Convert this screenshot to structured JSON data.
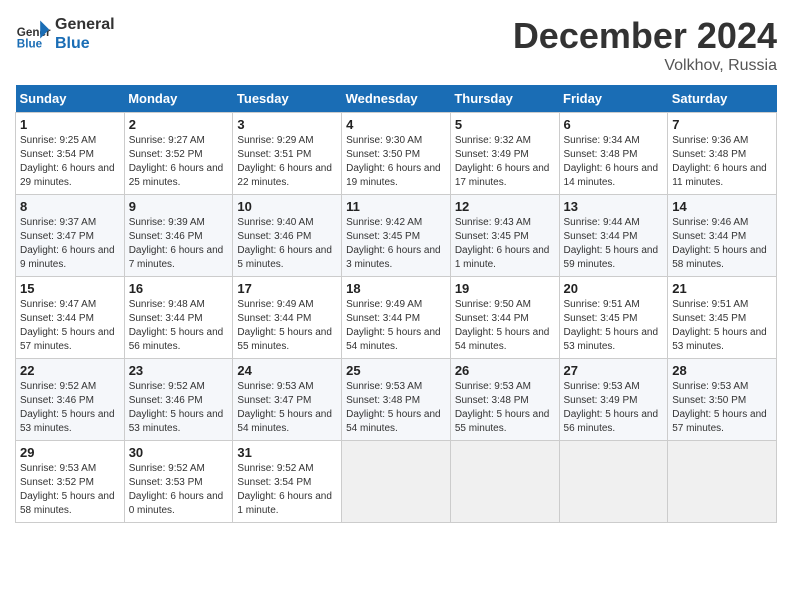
{
  "header": {
    "logo_line1": "General",
    "logo_line2": "Blue",
    "month": "December 2024",
    "location": "Volkhov, Russia"
  },
  "days_of_week": [
    "Sunday",
    "Monday",
    "Tuesday",
    "Wednesday",
    "Thursday",
    "Friday",
    "Saturday"
  ],
  "weeks": [
    [
      {
        "day": 1,
        "sunrise": "9:25 AM",
        "sunset": "3:54 PM",
        "daylight": "6 hours and 29 minutes."
      },
      {
        "day": 2,
        "sunrise": "9:27 AM",
        "sunset": "3:52 PM",
        "daylight": "6 hours and 25 minutes."
      },
      {
        "day": 3,
        "sunrise": "9:29 AM",
        "sunset": "3:51 PM",
        "daylight": "6 hours and 22 minutes."
      },
      {
        "day": 4,
        "sunrise": "9:30 AM",
        "sunset": "3:50 PM",
        "daylight": "6 hours and 19 minutes."
      },
      {
        "day": 5,
        "sunrise": "9:32 AM",
        "sunset": "3:49 PM",
        "daylight": "6 hours and 17 minutes."
      },
      {
        "day": 6,
        "sunrise": "9:34 AM",
        "sunset": "3:48 PM",
        "daylight": "6 hours and 14 minutes."
      },
      {
        "day": 7,
        "sunrise": "9:36 AM",
        "sunset": "3:48 PM",
        "daylight": "6 hours and 11 minutes."
      }
    ],
    [
      {
        "day": 8,
        "sunrise": "9:37 AM",
        "sunset": "3:47 PM",
        "daylight": "6 hours and 9 minutes."
      },
      {
        "day": 9,
        "sunrise": "9:39 AM",
        "sunset": "3:46 PM",
        "daylight": "6 hours and 7 minutes."
      },
      {
        "day": 10,
        "sunrise": "9:40 AM",
        "sunset": "3:46 PM",
        "daylight": "6 hours and 5 minutes."
      },
      {
        "day": 11,
        "sunrise": "9:42 AM",
        "sunset": "3:45 PM",
        "daylight": "6 hours and 3 minutes."
      },
      {
        "day": 12,
        "sunrise": "9:43 AM",
        "sunset": "3:45 PM",
        "daylight": "6 hours and 1 minute."
      },
      {
        "day": 13,
        "sunrise": "9:44 AM",
        "sunset": "3:44 PM",
        "daylight": "5 hours and 59 minutes."
      },
      {
        "day": 14,
        "sunrise": "9:46 AM",
        "sunset": "3:44 PM",
        "daylight": "5 hours and 58 minutes."
      }
    ],
    [
      {
        "day": 15,
        "sunrise": "9:47 AM",
        "sunset": "3:44 PM",
        "daylight": "5 hours and 57 minutes."
      },
      {
        "day": 16,
        "sunrise": "9:48 AM",
        "sunset": "3:44 PM",
        "daylight": "5 hours and 56 minutes."
      },
      {
        "day": 17,
        "sunrise": "9:49 AM",
        "sunset": "3:44 PM",
        "daylight": "5 hours and 55 minutes."
      },
      {
        "day": 18,
        "sunrise": "9:49 AM",
        "sunset": "3:44 PM",
        "daylight": "5 hours and 54 minutes."
      },
      {
        "day": 19,
        "sunrise": "9:50 AM",
        "sunset": "3:44 PM",
        "daylight": "5 hours and 54 minutes."
      },
      {
        "day": 20,
        "sunrise": "9:51 AM",
        "sunset": "3:45 PM",
        "daylight": "5 hours and 53 minutes."
      },
      {
        "day": 21,
        "sunrise": "9:51 AM",
        "sunset": "3:45 PM",
        "daylight": "5 hours and 53 minutes."
      }
    ],
    [
      {
        "day": 22,
        "sunrise": "9:52 AM",
        "sunset": "3:46 PM",
        "daylight": "5 hours and 53 minutes."
      },
      {
        "day": 23,
        "sunrise": "9:52 AM",
        "sunset": "3:46 PM",
        "daylight": "5 hours and 53 minutes."
      },
      {
        "day": 24,
        "sunrise": "9:53 AM",
        "sunset": "3:47 PM",
        "daylight": "5 hours and 54 minutes."
      },
      {
        "day": 25,
        "sunrise": "9:53 AM",
        "sunset": "3:48 PM",
        "daylight": "5 hours and 54 minutes."
      },
      {
        "day": 26,
        "sunrise": "9:53 AM",
        "sunset": "3:48 PM",
        "daylight": "5 hours and 55 minutes."
      },
      {
        "day": 27,
        "sunrise": "9:53 AM",
        "sunset": "3:49 PM",
        "daylight": "5 hours and 56 minutes."
      },
      {
        "day": 28,
        "sunrise": "9:53 AM",
        "sunset": "3:50 PM",
        "daylight": "5 hours and 57 minutes."
      }
    ],
    [
      {
        "day": 29,
        "sunrise": "9:53 AM",
        "sunset": "3:52 PM",
        "daylight": "5 hours and 58 minutes."
      },
      {
        "day": 30,
        "sunrise": "9:52 AM",
        "sunset": "3:53 PM",
        "daylight": "6 hours and 0 minutes."
      },
      {
        "day": 31,
        "sunrise": "9:52 AM",
        "sunset": "3:54 PM",
        "daylight": "6 hours and 1 minute."
      },
      null,
      null,
      null,
      null
    ]
  ]
}
